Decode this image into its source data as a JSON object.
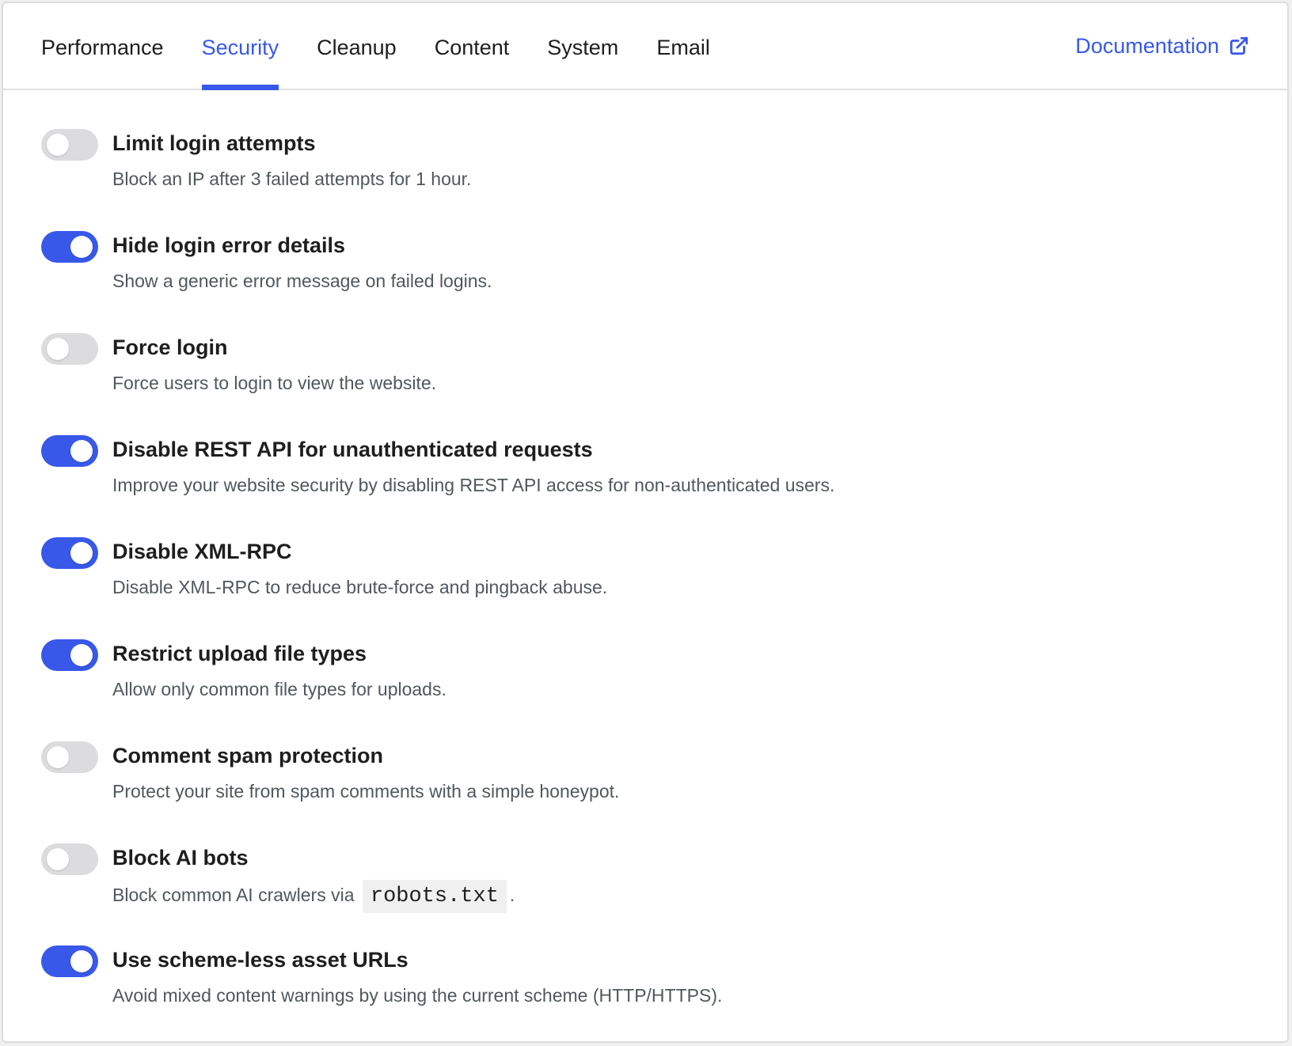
{
  "tabs": [
    {
      "label": "Performance",
      "active": false
    },
    {
      "label": "Security",
      "active": true
    },
    {
      "label": "Cleanup",
      "active": false
    },
    {
      "label": "Content",
      "active": false
    },
    {
      "label": "System",
      "active": false
    },
    {
      "label": "Email",
      "active": false
    }
  ],
  "documentation": {
    "label": "Documentation",
    "icon": "external-link-icon"
  },
  "colors": {
    "accent": "#3858e9",
    "toggle_off": "#dcdcde",
    "description": "#50575e"
  },
  "settings": [
    {
      "title": "Limit login attempts",
      "description": "Block an IP after 3 failed attempts for 1 hour.",
      "enabled": false
    },
    {
      "title": "Hide login error details",
      "description": "Show a generic error message on failed logins.",
      "enabled": true
    },
    {
      "title": "Force login",
      "description": "Force users to login to view the website.",
      "enabled": false
    },
    {
      "title": "Disable REST API for unauthenticated requests",
      "description": "Improve your website security by disabling REST API access for non-authenticated users.",
      "enabled": true
    },
    {
      "title": "Disable XML-RPC",
      "description": "Disable XML-RPC to reduce brute-force and pingback abuse.",
      "enabled": true
    },
    {
      "title": "Restrict upload file types",
      "description": "Allow only common file types for uploads.",
      "enabled": true
    },
    {
      "title": "Comment spam protection",
      "description": "Protect your site from spam comments with a simple honeypot.",
      "enabled": false
    },
    {
      "title": "Block AI bots",
      "description_prefix": "Block common AI crawlers via",
      "description_code": "robots.txt",
      "description_suffix": ".",
      "enabled": false
    },
    {
      "title": "Use scheme-less asset URLs",
      "description": "Avoid mixed content warnings by using the current scheme (HTTP/HTTPS).",
      "enabled": true
    }
  ]
}
